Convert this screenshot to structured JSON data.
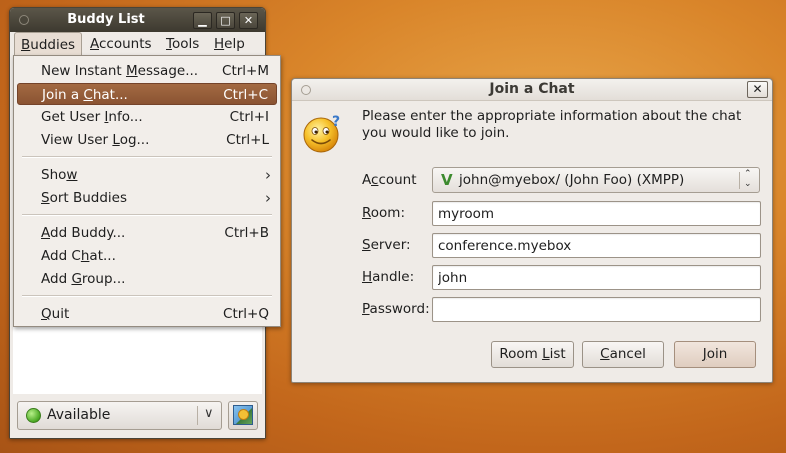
{
  "buddy_window": {
    "title": "Buddy List",
    "controls": {
      "minimize": "▁",
      "maximize": "□",
      "close": "✕"
    },
    "menubar": [
      {
        "label": "Buddies",
        "underline": "B",
        "rest": "uddies"
      },
      {
        "label": "Accounts",
        "underline": "A",
        "rest": "ccounts"
      },
      {
        "label": "Tools",
        "underline": "T",
        "rest": "ools"
      },
      {
        "label": "Help",
        "underline": "H",
        "rest": "elp"
      }
    ],
    "status": {
      "label": "Available",
      "icon": "green-dot-icon"
    },
    "avatar_icon": "buddy-icon"
  },
  "buddies_menu": {
    "items": [
      {
        "pre": "New Instant ",
        "u": "M",
        "post": "essage...",
        "accel": "Ctrl+M"
      },
      {
        "pre": "Join a ",
        "u": "C",
        "post": "hat...",
        "accel": "Ctrl+C",
        "highlighted": true
      },
      {
        "pre": "Get User ",
        "u": "I",
        "post": "nfo...",
        "accel": "Ctrl+I"
      },
      {
        "pre": "View User ",
        "u": "L",
        "post": "og...",
        "accel": "Ctrl+L"
      },
      {
        "pre": "Sho",
        "u": "w",
        "post": "",
        "submenu": true
      },
      {
        "pre": "",
        "u": "S",
        "post": "ort Buddies",
        "submenu": true
      },
      {
        "pre": "",
        "u": "A",
        "post": "dd Buddy...",
        "accel": "Ctrl+B"
      },
      {
        "pre": "Add C",
        "u": "h",
        "post": "at...",
        "accel": ""
      },
      {
        "pre": "Add ",
        "u": "G",
        "post": "roup...",
        "accel": ""
      },
      {
        "pre": "",
        "u": "Q",
        "post": "uit",
        "accel": "Ctrl+Q"
      }
    ],
    "submenu_arrow": "›"
  },
  "join_dialog": {
    "title": "Join a Chat",
    "close": "✕",
    "prompt": "Please enter the appropriate information about the chat you would like to join.",
    "account_label": {
      "pre": "A",
      "u": "c",
      "post": "count"
    },
    "account_value": "john@myebox/ (John Foo) (XMPP)",
    "account_icon": "xmpp-icon",
    "fields": {
      "room": {
        "pre": "",
        "u": "R",
        "post": "oom:",
        "value": "myroom"
      },
      "server": {
        "pre": "",
        "u": "S",
        "post": "erver:",
        "value": "conference.myebox"
      },
      "handle": {
        "pre": "",
        "u": "H",
        "post": "andle:",
        "value": "john"
      },
      "password": {
        "pre": "",
        "u": "P",
        "post": "assword:",
        "value": ""
      }
    },
    "buttons": {
      "room_list": {
        "pre": "Room ",
        "u": "L",
        "post": "ist"
      },
      "cancel": {
        "pre": "",
        "u": "C",
        "post": "ancel"
      },
      "join": {
        "pre": "",
        "u": "J",
        "post": "oin"
      }
    }
  }
}
